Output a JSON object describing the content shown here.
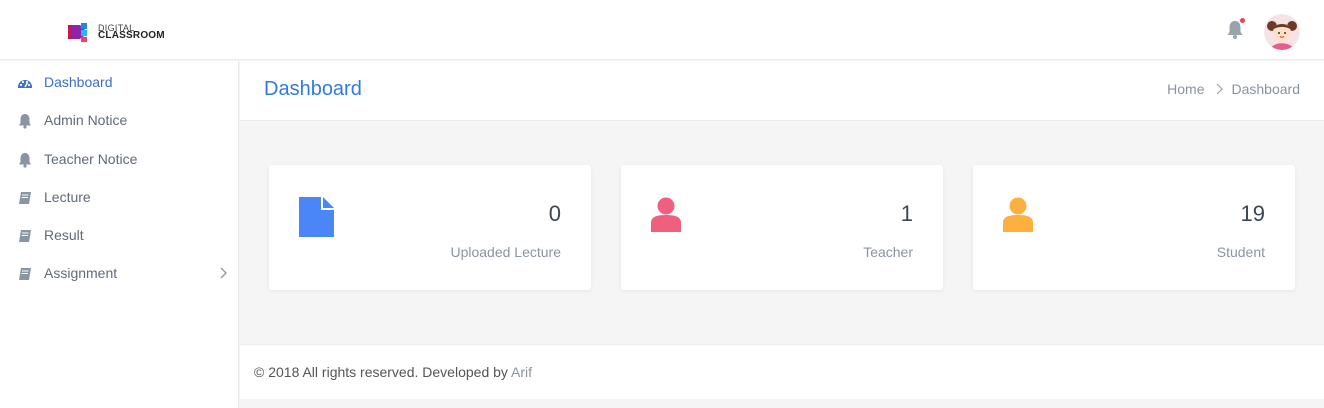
{
  "brand": {
    "line1": "DIGITAL",
    "line2": "CLASSROOM"
  },
  "header": {
    "notification_icon": "bell-icon",
    "avatar_icon": "user-avatar"
  },
  "sidebar": {
    "items": [
      {
        "label": "Dashboard",
        "icon": "dashboard-icon",
        "active": true
      },
      {
        "label": "Admin Notice",
        "icon": "bell-icon"
      },
      {
        "label": "Teacher Notice",
        "icon": "bell-icon"
      },
      {
        "label": "Lecture",
        "icon": "book-icon"
      },
      {
        "label": "Result",
        "icon": "book-icon"
      },
      {
        "label": "Assignment",
        "icon": "book-icon",
        "has_submenu": true
      }
    ]
  },
  "page": {
    "title": "Dashboard",
    "breadcrumb": {
      "home": "Home",
      "current": "Dashboard"
    }
  },
  "cards": [
    {
      "value": "0",
      "label": "Uploaded Lecture",
      "icon": "file-icon",
      "color": "#4a86f7"
    },
    {
      "value": "1",
      "label": "Teacher",
      "icon": "user-icon",
      "color": "#f0607e"
    },
    {
      "value": "19",
      "label": "Student",
      "icon": "user-icon",
      "color": "#fbb040"
    }
  ],
  "footer": {
    "text": "© 2018 All rights reserved. Developed by ",
    "author": "Arif"
  },
  "colors": {
    "accent": "#2e7be6",
    "notification_dot": "#e9445a"
  }
}
